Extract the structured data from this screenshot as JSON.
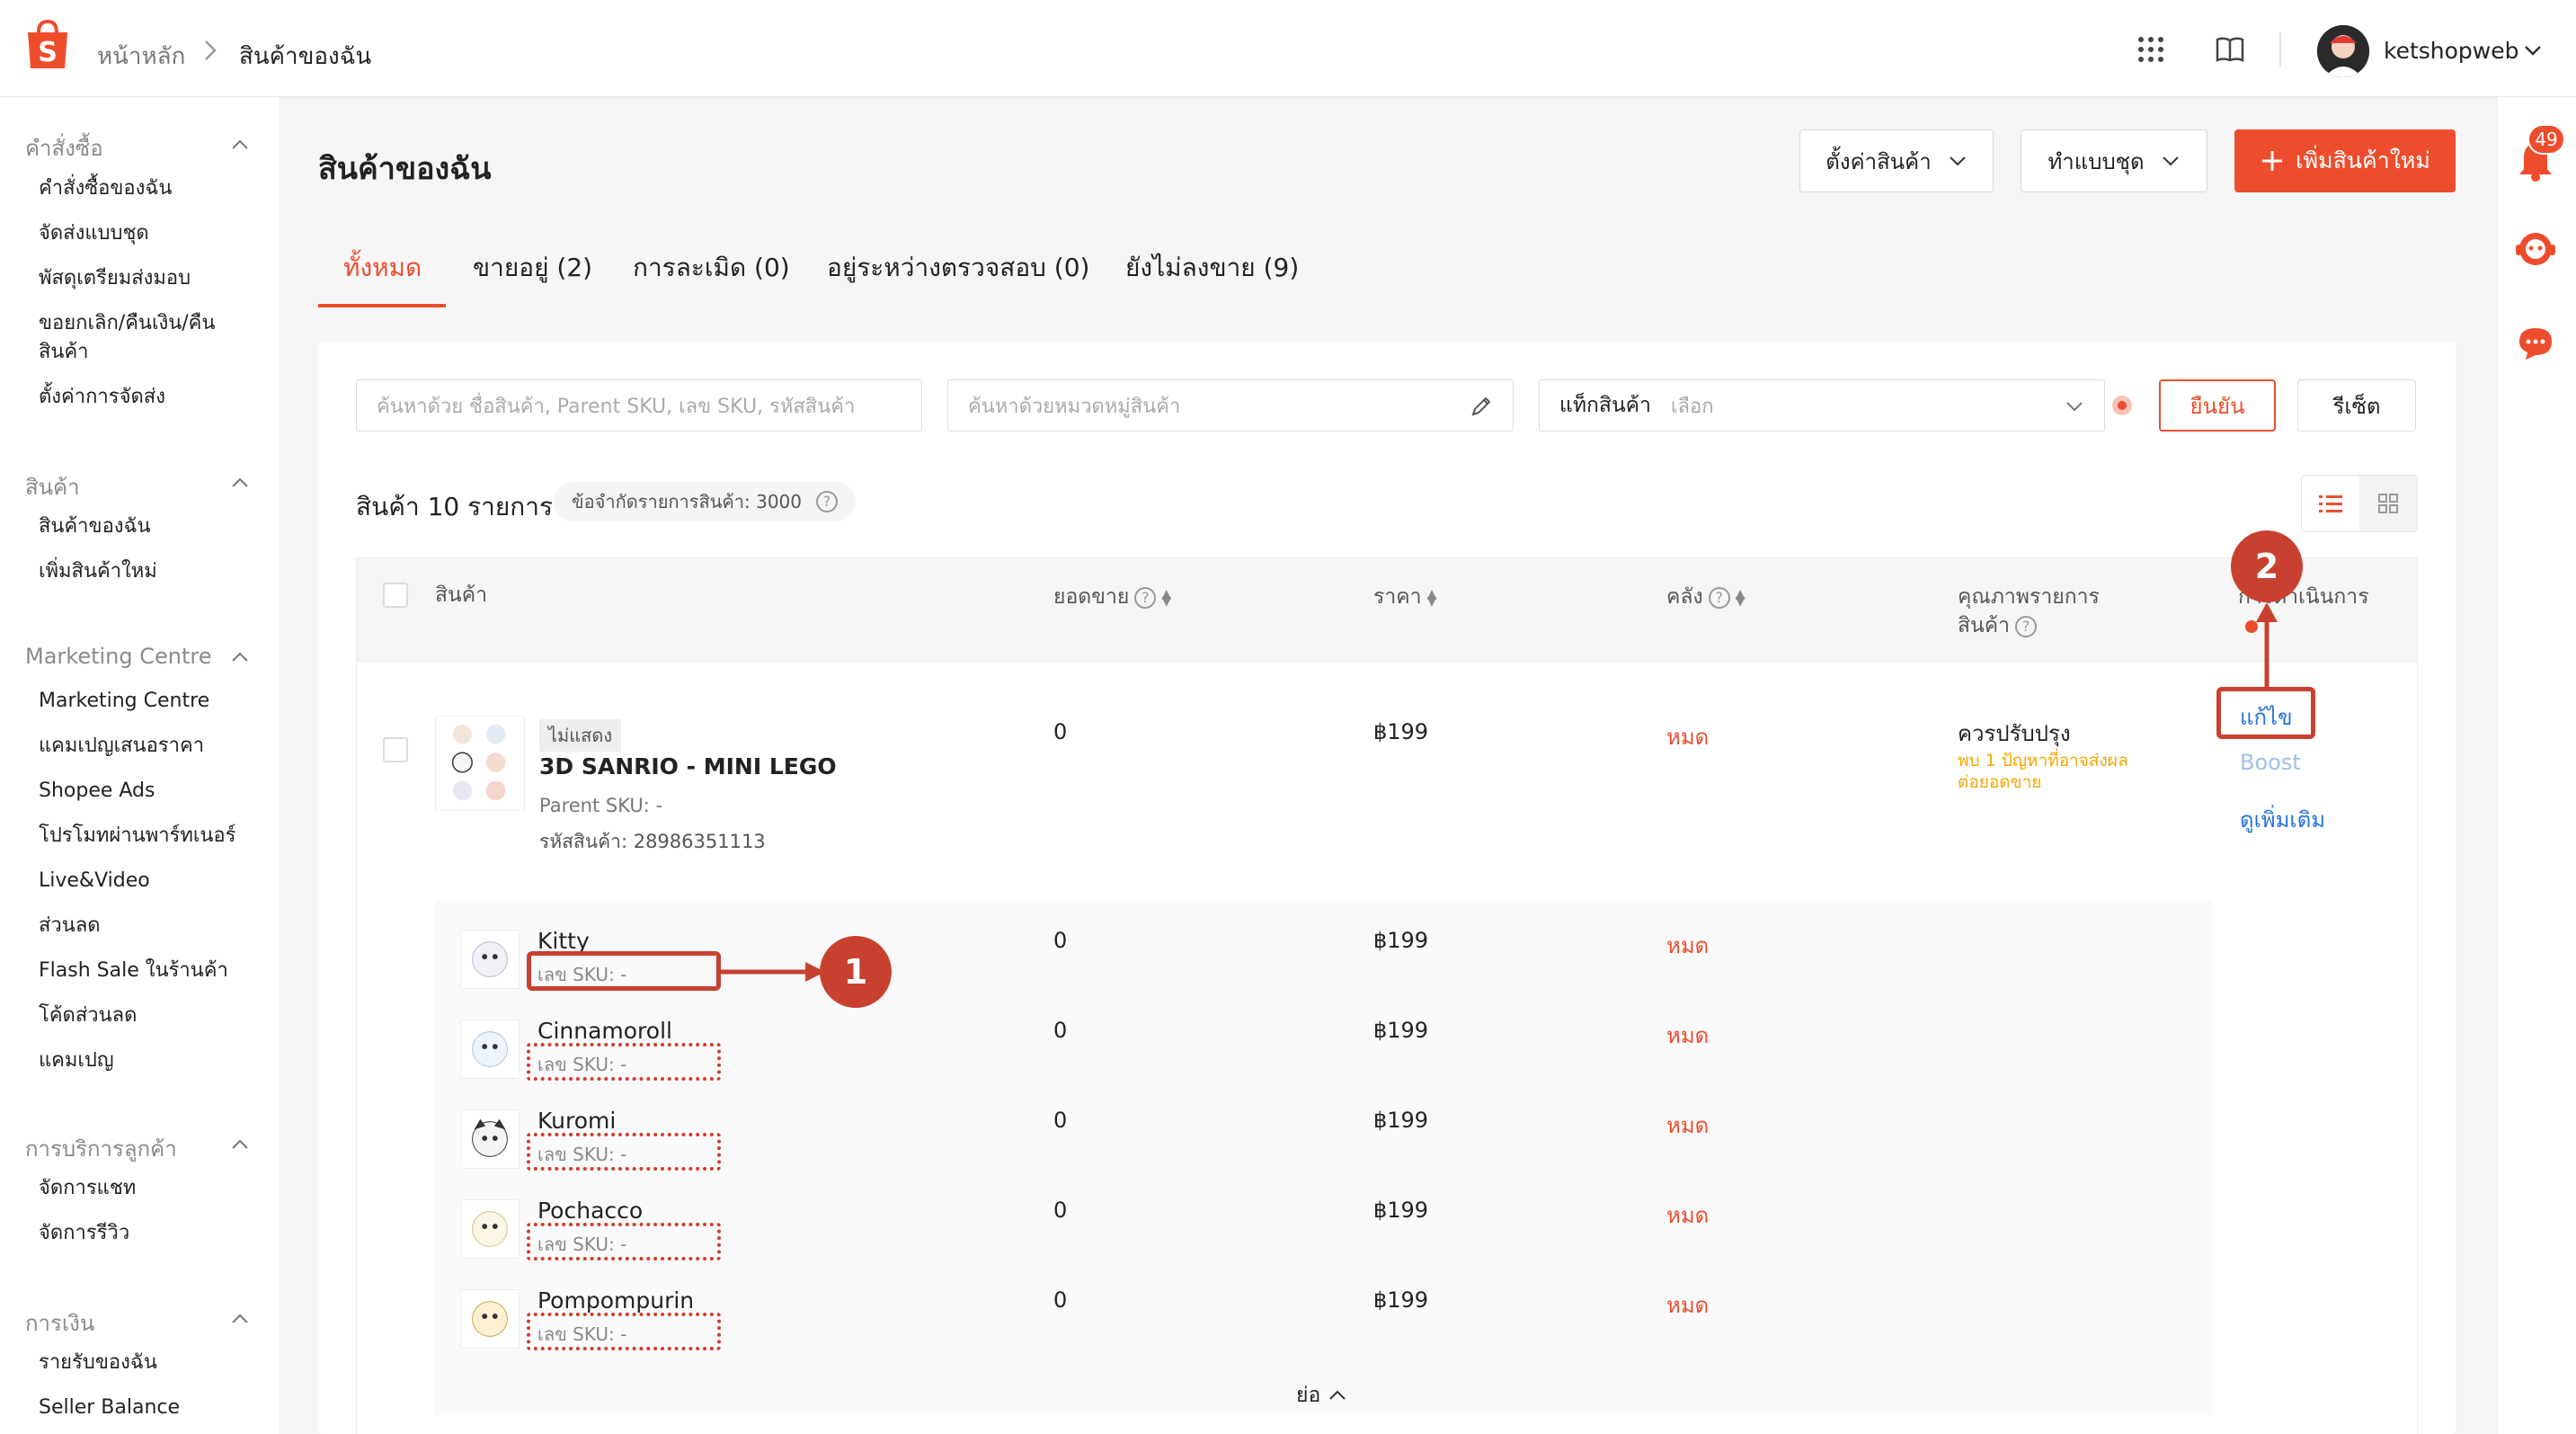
{
  "header": {
    "breadcrumb_home": "หน้าหลัก",
    "breadcrumb_sep": ">",
    "breadcrumb_current": "สินค้าของฉัน",
    "username": "ketshopweb",
    "notification_count": "49",
    "brand_color": "#ee4d2d"
  },
  "sidebar": {
    "sections": [
      {
        "title": "คำสั่งซื้อ",
        "items": [
          "คำสั่งซื้อของฉัน",
          "จัดส่งแบบชุด",
          "พัสดุเตรียมส่งมอบ",
          "ขอยกเลิก/คืนเงิน/คืนสินค้า",
          "ตั้งค่าการจัดส่ง"
        ]
      },
      {
        "title": "สินค้า",
        "items": [
          "สินค้าของฉัน",
          "เพิ่มสินค้าใหม่"
        ]
      },
      {
        "title": "Marketing Centre",
        "items": [
          "Marketing Centre",
          "แคมเปญเสนอราคา",
          "Shopee Ads",
          "โปรโมทผ่านพาร์ทเนอร์",
          "Live&Video",
          "ส่วนลด",
          "Flash Sale ในร้านค้า",
          "โค้ดส่วนลด",
          "แคมเปญ"
        ]
      },
      {
        "title": "การบริการลูกค้า",
        "items": [
          "จัดการแชท",
          "จัดการรีวิว"
        ]
      },
      {
        "title": "การเงิน",
        "items": [
          "รายรับของฉัน",
          "Seller Balance"
        ]
      }
    ]
  },
  "main": {
    "title": "สินค้าของฉัน",
    "btn_settings": "ตั้งค่าสินค้า",
    "btn_batch": "ทำแบบชุด",
    "btn_add": "เพิ่มสินค้าใหม่",
    "tabs": [
      "ทั้งหมด",
      "ขายอยู่ (2)",
      "การละเมิด (0)",
      "อยู่ระหว่างตรวจสอบ (0)",
      "ยังไม่ลงขาย (9)"
    ],
    "search_placeholder": "ค้นหาด้วย ชื่อสินค้า, Parent SKU, เลข SKU, รหัสสินค้า",
    "category_placeholder": "ค้นหาด้วยหมวดหมู่สินค้า",
    "tag_label": "แท็กสินค้า",
    "tag_placeholder": "เลือก",
    "btn_confirm": "ยืนยัน",
    "btn_reset": "รีเซ็ต",
    "count_title": "สินค้า 10 รายการ",
    "limit_text": "ข้อจำกัดรายการสินค้า: 3000"
  },
  "table": {
    "col_product": "สินค้า",
    "col_sales": "ยอดขาย",
    "col_price": "ราคา",
    "col_stock": "คลัง",
    "col_quality_1": "คุณภาพรายการ",
    "col_quality_2": "สินค้า",
    "col_action": "การดำเนินการ",
    "product": {
      "tag": "ไม่แสดง",
      "name": "3D SANRIO - MINI LEGO",
      "parent_sku": "Parent SKU: -",
      "product_id": "รหัสสินค้า: 28986351113",
      "sales": "0",
      "price": "฿199",
      "stock": "หมด",
      "quality": "ควรปรับปรุง",
      "quality_warn": "พบ 1 ปัญหาที่อาจส่งผลต่อยอดขาย",
      "act_edit": "แก้ไข",
      "act_boost": "Boost",
      "act_more": "ดูเพิ่มเติม"
    },
    "variants": [
      {
        "name": "Kitty",
        "sku": "เลข SKU: -",
        "sales": "0",
        "price": "฿199",
        "stock": "หมด"
      },
      {
        "name": "Cinnamoroll",
        "sku": "เลข SKU: -",
        "sales": "0",
        "price": "฿199",
        "stock": "หมด"
      },
      {
        "name": "Kuromi",
        "sku": "เลข SKU: -",
        "sales": "0",
        "price": "฿199",
        "stock": "หมด"
      },
      {
        "name": "Pochacco",
        "sku": "เลข SKU: -",
        "sales": "0",
        "price": "฿199",
        "stock": "หมด"
      },
      {
        "name": "Pompompurin",
        "sku": "เลข SKU: -",
        "sales": "0",
        "price": "฿199",
        "stock": "หมด"
      }
    ],
    "collapse_label": "ย่อ"
  },
  "annotations": {
    "marker_1": "1",
    "marker_2": "2",
    "color": "#c84130"
  }
}
